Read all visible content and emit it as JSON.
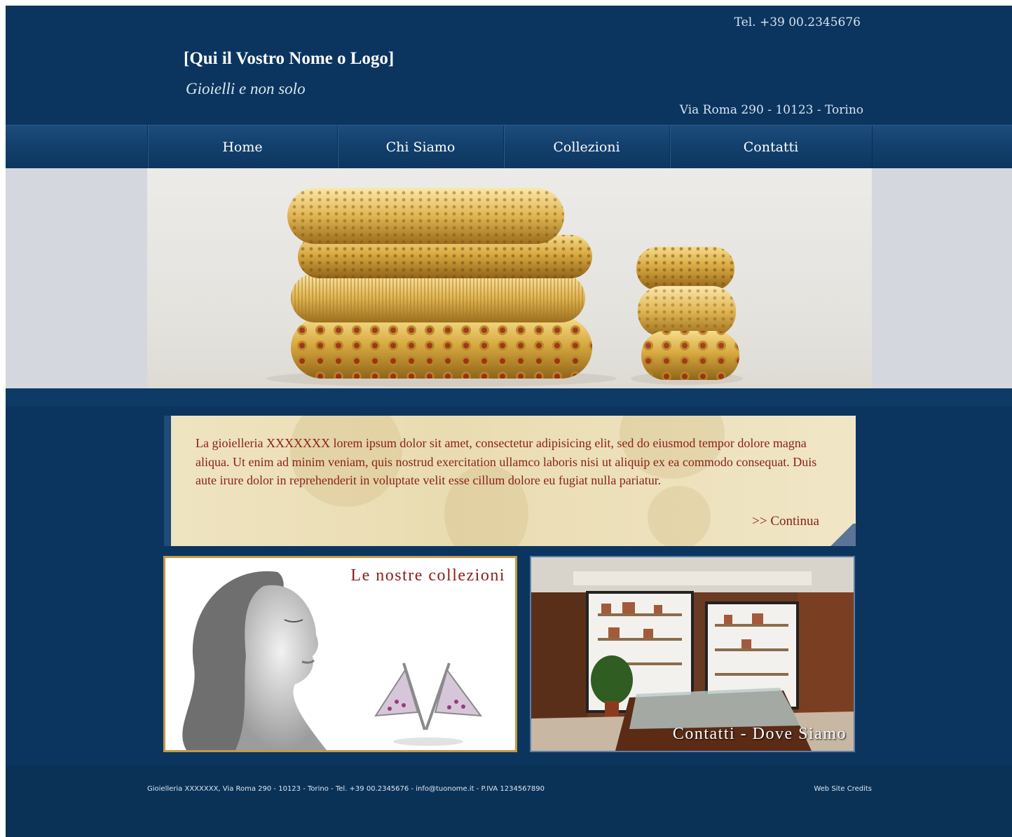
{
  "header": {
    "phone": "Tel. +39 00.2345676",
    "logo": "[Qui il Vostro Nome o Logo]",
    "tagline": "Gioielli e non solo",
    "address": "Via Roma 290 - 10123 - Torino"
  },
  "nav": {
    "items": [
      {
        "label": "Home"
      },
      {
        "label": "Chi Siamo"
      },
      {
        "label": "Collezioni"
      },
      {
        "label": "Contatti"
      }
    ]
  },
  "intro": {
    "text": "La gioielleria XXXXXXX lorem ipsum dolor sit amet, consectetur adipisicing elit, sed do eiusmod tempor dolore magna aliqua. Ut enim ad minim veniam, quis nostrud exercitation ullamco laboris nisi ut aliquip ex ea commodo consequat. Duis aute irure dolor in reprehenderit in voluptate velit esse cillum dolore eu fugiat nulla pariatur.",
    "more_label": ">> Continua"
  },
  "tiles": {
    "collections_title": "Le nostre collezioni",
    "contacts_title": "Contatti - Dove Siamo"
  },
  "footer": {
    "info": "Gioielleria XXXXXXX, Via Roma 290 - 10123 - Torino - Tel. +39 00.2345676 - info@tuonome.it - P.IVA 1234567890",
    "credits": "Web Site Credits"
  },
  "colors": {
    "background": "#0b355e",
    "accent_text": "#8b1f1a",
    "gold": "#c49a45"
  }
}
